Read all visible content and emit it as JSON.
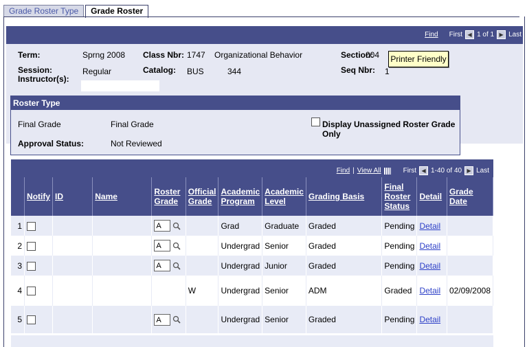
{
  "tabs": [
    {
      "label": "Grade Roster Type",
      "active": false
    },
    {
      "label": "Grade Roster",
      "active": true
    }
  ],
  "header_nav": {
    "find": "Find",
    "first": "First",
    "range": "1 of 1",
    "last": "Last"
  },
  "info": {
    "term_label": "Term:",
    "term_value": "Sprng 2008",
    "class_nbr_label": "Class Nbr:",
    "class_nbr_value": "1747",
    "course_title": "Organizational Behavior",
    "section_label": "Section:",
    "section_value": "004",
    "printer_friendly": "Printer Friendly",
    "session_label": "Session:",
    "session_value": "Regular",
    "catalog_label": "Catalog:",
    "catalog_subject": "BUS",
    "catalog_number": "344",
    "seq_nbr_label": "Seq Nbr:",
    "seq_nbr_value": "1",
    "instructor_label": "Instructor(s):"
  },
  "roster_type": {
    "title": "Roster Type",
    "final_grade_label": "Final Grade",
    "final_grade_value": "Final Grade",
    "display_unassigned": "Display Unassigned Roster Grade Only",
    "approval_label": "Approval Status:",
    "approval_value": "Not Reviewed"
  },
  "grid_nav": {
    "find": "Find",
    "view_all": "View All",
    "first": "First",
    "range": "1-40 of 40",
    "last": "Last"
  },
  "columns": [
    "Notify",
    "ID",
    "Name",
    "Roster Grade",
    "Official Grade",
    "Academic Program",
    "Academic Level",
    "Grading Basis",
    "Final Roster Status",
    "Detail",
    "Grade Date"
  ],
  "rows": [
    {
      "num": "1",
      "roster_grade": "A",
      "official_grade": "",
      "program": "Grad",
      "level": "Graduate",
      "basis": "Graded",
      "status": "Pending",
      "detail": "Detail",
      "date": ""
    },
    {
      "num": "2",
      "roster_grade": "A",
      "official_grade": "",
      "program": "Undergrad",
      "level": "Senior",
      "basis": "Graded",
      "status": "Pending",
      "detail": "Detail",
      "date": ""
    },
    {
      "num": "3",
      "roster_grade": "A",
      "official_grade": "",
      "program": "Undergrad",
      "level": "Junior",
      "basis": "Graded",
      "status": "Pending",
      "detail": "Detail",
      "date": ""
    },
    {
      "num": "4",
      "roster_grade": "",
      "official_grade": "W",
      "program": "Undergrad",
      "level": "Senior",
      "basis": "ADM",
      "status": "Graded",
      "detail": "Detail",
      "date": "02/09/2008"
    },
    {
      "num": "5",
      "roster_grade": "A",
      "official_grade": "",
      "program": "Undergrad",
      "level": "Senior",
      "basis": "Graded",
      "status": "Pending",
      "detail": "Detail",
      "date": ""
    }
  ],
  "icons": {
    "lookup": "magnifier-icon",
    "prev": "prev-arrow-icon",
    "next": "next-arrow-icon",
    "grid": "grid-icon"
  },
  "colors": {
    "header_bar": "#464e8a",
    "panel": "#e6e8f3",
    "row_alt": "#e8ebf6",
    "link": "#2c3fc7",
    "button": "#ffffc8"
  }
}
